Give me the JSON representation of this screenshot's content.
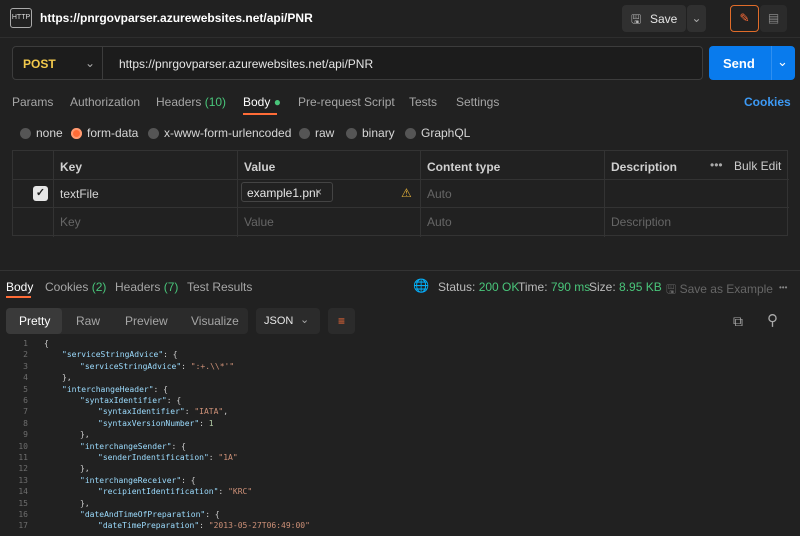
{
  "header": {
    "title": "https://pnrgovparser.azurewebsites.net/api/PNR",
    "save_label": "Save",
    "app_icon": "HTTP"
  },
  "request": {
    "method": "POST",
    "url": "https://pnrgovparser.azurewebsites.net/api/PNR",
    "send_label": "Send"
  },
  "tabs": {
    "params": "Params",
    "authorization": "Authorization",
    "headers": "Headers",
    "headers_count": "(10)",
    "body": "Body",
    "pre_request": "Pre-request Script",
    "tests": "Tests",
    "settings": "Settings",
    "cookies": "Cookies"
  },
  "body_types": [
    "none",
    "form-data",
    "x-www-form-urlencoded",
    "raw",
    "binary",
    "GraphQL"
  ],
  "table": {
    "headers": [
      "Key",
      "Value",
      "Content type",
      "Description"
    ],
    "bulk_edit": "Bulk Edit",
    "row": {
      "key": "textFile",
      "value": "example1.pnr",
      "content_type": "Auto"
    },
    "placeholders": {
      "key": "Key",
      "value": "Value",
      "content_type": "Auto",
      "description": "Description"
    }
  },
  "response": {
    "tabs": {
      "body": "Body",
      "cookies": "Cookies",
      "cookies_count": "(2)",
      "headers": "Headers",
      "headers_count": "(7)",
      "test_results": "Test Results"
    },
    "status_label": "Status:",
    "status": "200 OK",
    "time_label": "Time:",
    "time": "790 ms",
    "size_label": "Size:",
    "size": "8.95 KB",
    "save_example": "Save as Example",
    "views": [
      "Pretty",
      "Raw",
      "Preview",
      "Visualize"
    ],
    "format": "JSON"
  },
  "code_lines": [
    {
      "n": "1",
      "i": 0,
      "t": "{"
    },
    {
      "n": "2",
      "i": 1,
      "k": "\"serviceStringAdvice\"",
      "t": ": {"
    },
    {
      "n": "3",
      "i": 2,
      "k": "\"serviceStringAdvice\"",
      "t": ": ",
      "s": "\":+.\\\\*'\""
    },
    {
      "n": "4",
      "i": 1,
      "t": "},"
    },
    {
      "n": "5",
      "i": 1,
      "k": "\"interchangeHeader\"",
      "t": ": {"
    },
    {
      "n": "6",
      "i": 2,
      "k": "\"syntaxIdentifier\"",
      "t": ": {"
    },
    {
      "n": "7",
      "i": 3,
      "k": "\"syntaxIdentifier\"",
      "t": ": ",
      "s": "\"IATA\"",
      "e": ","
    },
    {
      "n": "8",
      "i": 3,
      "k": "\"syntaxVersionNumber\"",
      "t": ": ",
      "v": "1"
    },
    {
      "n": "9",
      "i": 2,
      "t": "},"
    },
    {
      "n": "10",
      "i": 2,
      "k": "\"interchangeSender\"",
      "t": ": {"
    },
    {
      "n": "11",
      "i": 3,
      "k": "\"senderIndentification\"",
      "t": ": ",
      "s": "\"1A\""
    },
    {
      "n": "12",
      "i": 2,
      "t": "},"
    },
    {
      "n": "13",
      "i": 2,
      "k": "\"interchangeReceiver\"",
      "t": ": {"
    },
    {
      "n": "14",
      "i": 3,
      "k": "\"recipientIdentification\"",
      "t": ": ",
      "s": "\"KRC\""
    },
    {
      "n": "15",
      "i": 2,
      "t": "},"
    },
    {
      "n": "16",
      "i": 2,
      "k": "\"dateAndTimeOfPreparation\"",
      "t": ": {"
    },
    {
      "n": "17",
      "i": 3,
      "k": "\"dateTimePreparation\"",
      "t": ": ",
      "s": "\"2013-05-27T06:49:00\""
    }
  ]
}
